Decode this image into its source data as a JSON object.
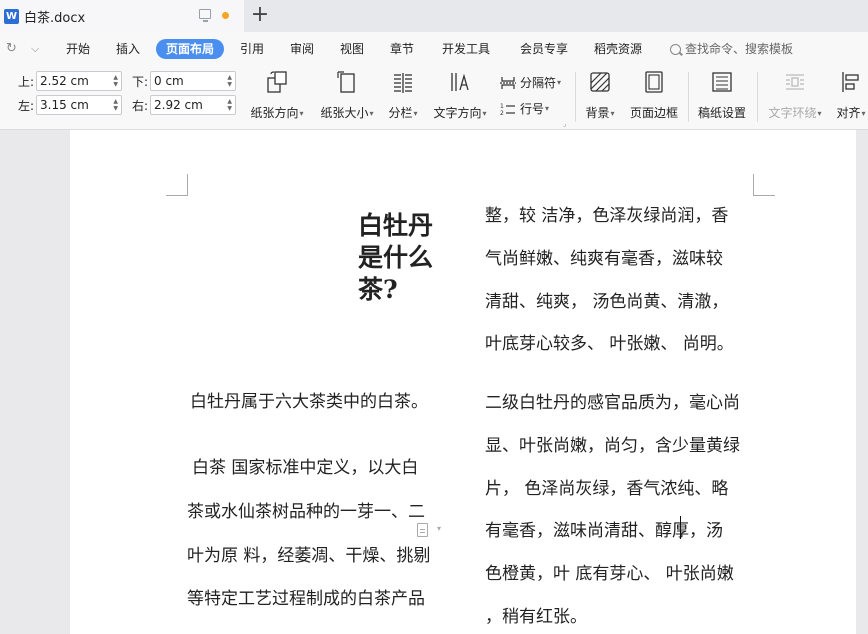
{
  "window": {
    "doc_title": "白茶.docx",
    "app_logo": "W",
    "new_tab_glyph": "+"
  },
  "menubar": {
    "undo_glyph": "↻",
    "dropdown_glyph": "⌵",
    "tabs": [
      "开始",
      "插入",
      "页面布局",
      "引用",
      "审阅",
      "视图",
      "章节",
      "开发工具",
      "会员专享",
      "稻壳资源"
    ],
    "active_tab": "页面布局",
    "search_label": "查找命令、搜索模板"
  },
  "toolbar": {
    "margins": {
      "top_label": "上:",
      "top_value": "2.52 cm",
      "bottom_label": "下:",
      "bottom_value": "0 cm",
      "left_label": "左:",
      "left_value": "3.15 cm",
      "right_label": "右:",
      "right_value": "2.92 cm"
    },
    "orientation": "纸张方向",
    "paper_size": "纸张大小",
    "columns": "分栏",
    "text_direction": "文字方向",
    "separator": "分隔符",
    "line_number": "行号",
    "background": "背景",
    "page_border": "页面边框",
    "manuscript": "稿纸设置",
    "text_wrap": "文字环绕",
    "align": "对齐"
  },
  "document": {
    "heading_lines": [
      "白牡丹",
      "是什么",
      "茶?"
    ],
    "left_column": [
      "白牡丹属于六大茶类中的白茶。",
      " 白茶  国家标准中定义，以大白",
      "茶或水仙茶树品种的一芽一、二",
      "叶为原 料，经萎凋、干燥、挑剔",
      "等特定工艺过程制成的白茶产品"
    ],
    "right_column": [
      "整，较 洁净，色泽灰绿尚润，香",
      "气尚鲜嫩、纯爽有毫香，滋味较",
      "清甜、纯爽， 汤色尚黄、清澈，",
      "叶底芽心较多、 叶张嫩、 尚明。",
      "二级白牡丹的感官品质为，毫心尚",
      "显、叶张尚嫩，尚匀，含少量黄绿",
      "片， 色泽尚灰绿，香气浓纯、略",
      "有毫香，滋味尚清甜、醇厚，汤",
      "色橙黄，叶  底有芽心、 叶张尚嫩",
      "，稍有红张。"
    ]
  }
}
